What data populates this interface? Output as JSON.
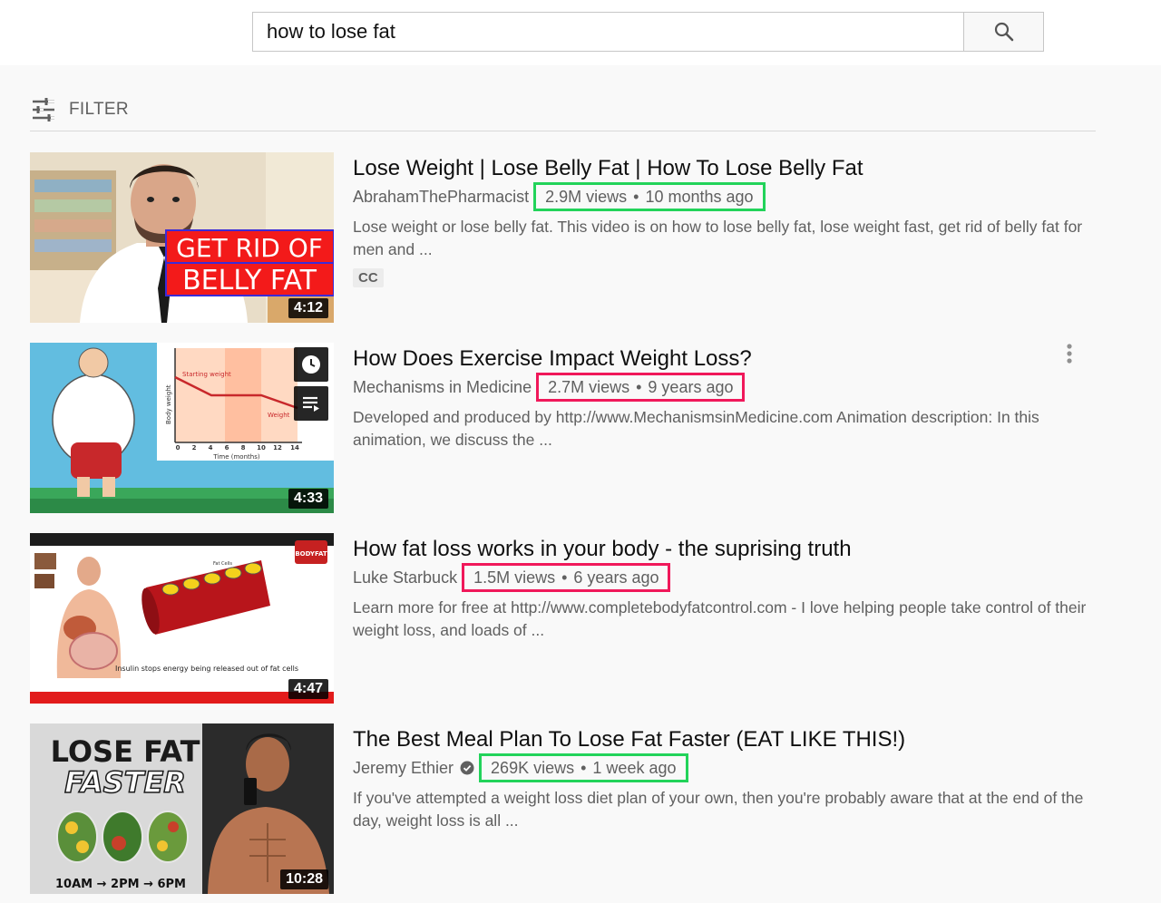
{
  "search": {
    "query": "how to lose fat"
  },
  "filter": {
    "label": "FILTER"
  },
  "highlight_colors": {
    "green": "#22d35a",
    "red": "#f0185a"
  },
  "results": [
    {
      "title": "Lose Weight | Lose Belly Fat | How To Lose Belly Fat",
      "channel": "AbrahamThePharmacist",
      "views": "2.9M views",
      "age": "10 months ago",
      "description": "Lose weight or lose belly fat. This video is on how to lose belly fat, lose weight fast, get rid of belly fat for men and ...",
      "badge": "CC",
      "duration": "4:12",
      "thumb_text": [
        "GET RID OF",
        "BELLY FAT"
      ]
    },
    {
      "title": "How Does Exercise Impact Weight Loss?",
      "channel": "Mechanisms in Medicine",
      "views": "2.7M views",
      "age": "9 years ago",
      "description": "Developed and produced by http://www.MechanismsinMedicine.com Animation description: In this animation, we discuss the ...",
      "duration": "4:33",
      "thumb_text": {
        "starting": "Starting weight",
        "weight": "Weight",
        "ylabel": "Body weight",
        "xlabel": "Time (months)",
        "ticks": [
          "0",
          "2",
          "4",
          "6",
          "8",
          "10",
          "12",
          "14"
        ]
      }
    },
    {
      "title": "How fat loss works in your body - the suprising truth",
      "channel": "Luke Starbuck",
      "views": "1.5M views",
      "age": "6 years ago",
      "description": "Learn more for free at http://www.completebodyfatcontrol.com - I love helping people take control of their weight loss, and loads of ...",
      "duration": "4:47",
      "thumb_text": {
        "logo": "BODYFAT",
        "cells": "Fat Cells",
        "caption": "Insulin stops energy being released out of fat cells"
      }
    },
    {
      "title": "The Best Meal Plan To Lose Fat Faster (EAT LIKE THIS!)",
      "channel": "Jeremy Ethier",
      "views": "269K views",
      "age": "1 week ago",
      "description": "If you've attempted a weight loss diet plan of your own, then you're probably aware that at the end of the day, weight loss is all ...",
      "duration": "10:28",
      "thumb_text": {
        "line1": "LOSE FAT",
        "line2": "FASTER",
        "times": "10AM → 2PM → 6PM"
      }
    }
  ]
}
